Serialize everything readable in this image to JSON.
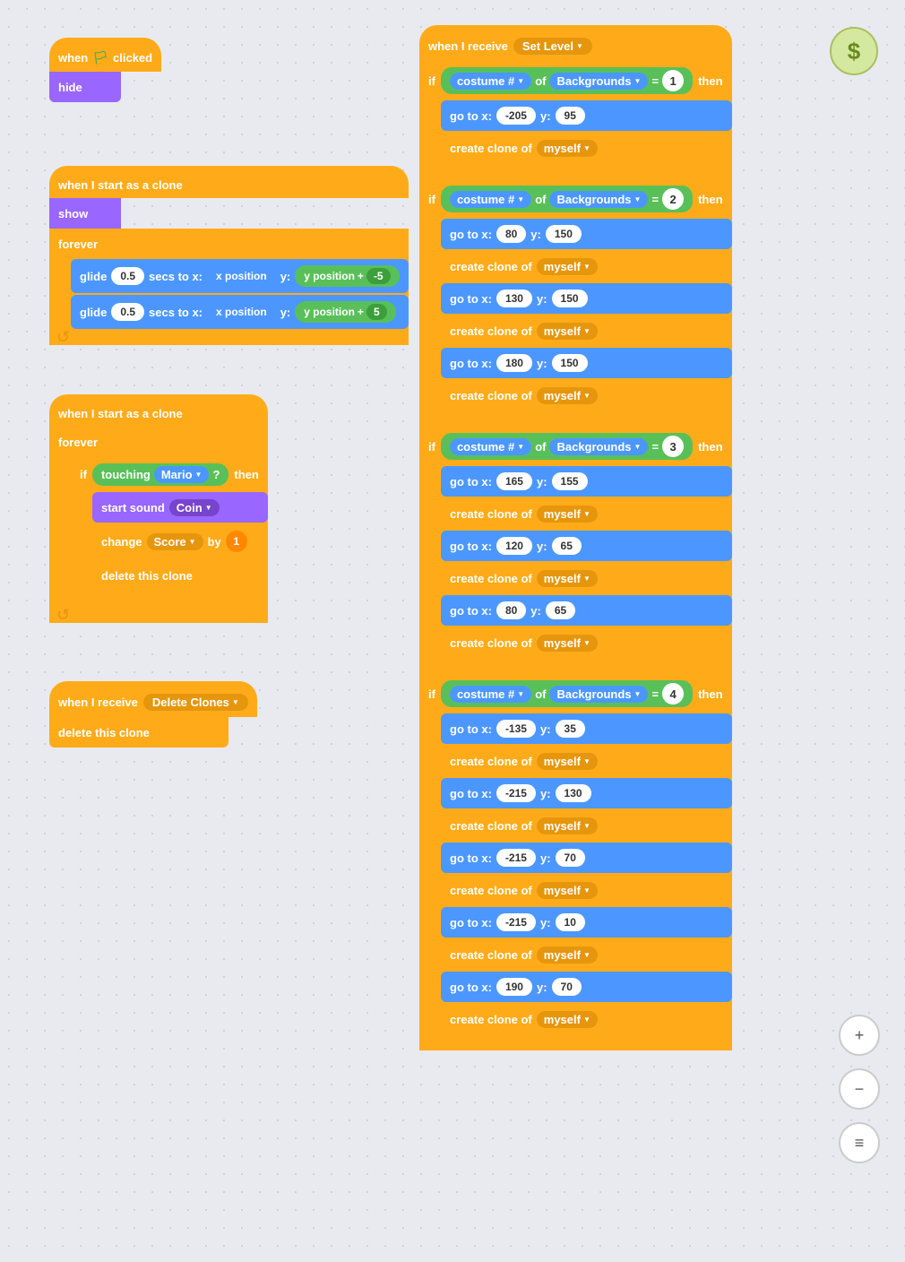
{
  "blocks": {
    "stack1": {
      "hat": "when 🏳 clicked",
      "b1": "hide"
    },
    "stack2": {
      "hat": "when I start as a clone",
      "b1": "show",
      "forever": "forever",
      "glide1": {
        "secs": "0.5",
        "x_label": "x position",
        "y_label": "y position",
        "op": "+",
        "val": "-5"
      },
      "glide2": {
        "secs": "0.5",
        "x_label": "x position",
        "y_label": "y position",
        "op": "+",
        "val": "5"
      }
    },
    "stack3": {
      "hat": "when I start as a clone",
      "forever": "forever",
      "if_touch": "touching",
      "mario": "Mario",
      "then": "then",
      "sound": "start sound",
      "coin": "Coin",
      "change": "change",
      "score": "Score",
      "by": "by",
      "val": "1",
      "delete": "delete this clone"
    },
    "stack4": {
      "hat": "when I receive",
      "msg": "Delete Clones",
      "delete": "delete this clone"
    },
    "right_hat": "when I receive",
    "right_msg": "Set Level",
    "dollar": "$",
    "if1": {
      "label": "if",
      "costume": "costume #",
      "of": "of",
      "bg": "Backgrounds",
      "eq": "=",
      "num": "1",
      "then": "then",
      "goto1": {
        "x": "-205",
        "y": "95"
      },
      "clone1": "create clone of",
      "myself": "myself"
    },
    "if2": {
      "label": "if",
      "costume": "costume #",
      "of": "of",
      "bg": "Backgrounds",
      "eq": "=",
      "num": "2",
      "then": "then",
      "gotos": [
        {
          "x": "80",
          "y": "150"
        },
        {
          "x": "130",
          "y": "150"
        },
        {
          "x": "180",
          "y": "150"
        }
      ]
    },
    "if3": {
      "label": "if",
      "costume": "costume #",
      "of": "of",
      "bg": "Backgrounds",
      "eq": "=",
      "num": "3",
      "then": "then",
      "gotos": [
        {
          "x": "165",
          "y": "155"
        },
        {
          "x": "120",
          "y": "65"
        },
        {
          "x": "80",
          "y": "65"
        }
      ]
    },
    "if4": {
      "label": "if",
      "costume": "costume #",
      "of": "of",
      "bg": "Backgrounds",
      "eq": "=",
      "num": "4",
      "then": "then",
      "gotos": [
        {
          "x": "-135",
          "y": "35"
        },
        {
          "x": "-215",
          "y": "130"
        },
        {
          "x": "-215",
          "y": "70"
        },
        {
          "x": "-215",
          "y": "10"
        },
        {
          "x": "190",
          "y": "70"
        }
      ]
    }
  },
  "zoom_in": "+",
  "zoom_out": "−",
  "menu": "≡"
}
